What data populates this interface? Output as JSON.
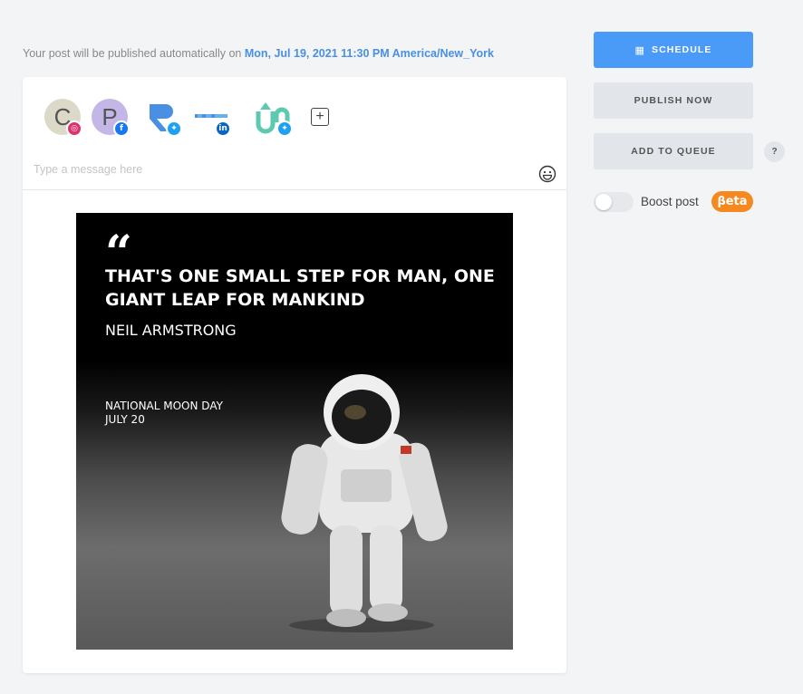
{
  "publish_info": {
    "prefix": "Your post will be published automatically on",
    "datetime": "Mon, Jul 19, 2021 11:30 PM America/New_York"
  },
  "accounts": [
    {
      "initial": "C",
      "avatar_color": "#ddd9c8",
      "network": "instagram-icon",
      "network_glyph": "◎"
    },
    {
      "initial": "P",
      "avatar_color": "#c4b7e8",
      "network": "facebook-icon",
      "network_glyph": "f"
    },
    {
      "initial": "",
      "avatar_color": "#ffffff",
      "network": "twitter-icon",
      "network_glyph": "✦"
    },
    {
      "initial": "",
      "avatar_color": "#ffffff",
      "network": "linkedin-icon",
      "network_glyph": "in"
    },
    {
      "initial": "",
      "avatar_color": "#ffffff",
      "network": "twitter-icon",
      "network_glyph": "✦"
    }
  ],
  "add_account_glyph": "+",
  "message": {
    "placeholder": "Type a message here"
  },
  "post_image": {
    "quote_mark": "“",
    "quote": "THAT'S ONE SMALL STEP FOR MAN, ONE GIANT LEAP FOR MANKIND",
    "author": "NEIL ARMSTRONG",
    "event_line1": "NATIONAL MOON DAY",
    "event_line2": "JULY 20"
  },
  "actions": {
    "schedule_icon": "▦",
    "schedule": "SCHEDULE",
    "publish_now": "PUBLISH NOW",
    "add_to_queue": "ADD TO QUEUE",
    "help": "?",
    "boost_label": "Boost post",
    "boost_enabled": false,
    "beta": "βeta"
  },
  "colors": {
    "accent": "#4a9bf8",
    "date_link": "#4a90e2",
    "beta_badge": "#f5891f"
  }
}
